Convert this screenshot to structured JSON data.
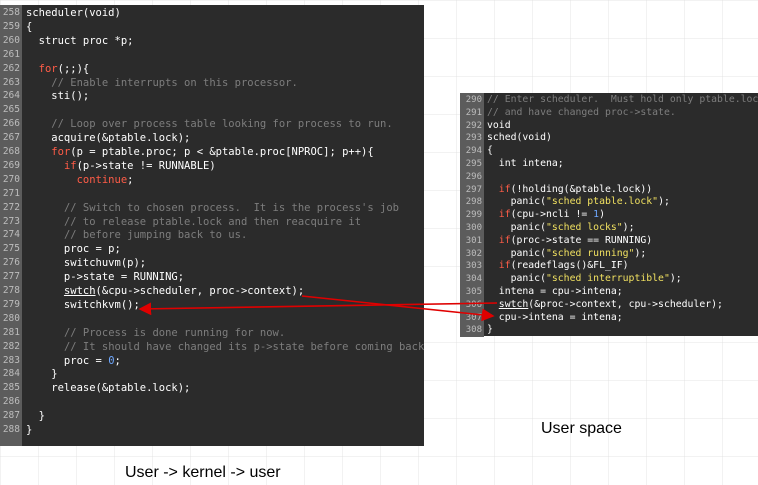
{
  "left_panel": {
    "lines": [
      {
        "num": "258",
        "segs": [
          {
            "t": "scheduler(void)"
          }
        ]
      },
      {
        "num": "259",
        "segs": [
          {
            "t": "{"
          }
        ]
      },
      {
        "num": "260",
        "segs": [
          {
            "t": "  struct proc *p;"
          }
        ]
      },
      {
        "num": "261",
        "segs": [
          {
            "t": ""
          }
        ]
      },
      {
        "num": "262",
        "segs": [
          {
            "t": "  "
          },
          {
            "t": "for",
            "c": "kw"
          },
          {
            "t": "(;;){"
          }
        ]
      },
      {
        "num": "263",
        "segs": [
          {
            "t": "    "
          },
          {
            "t": "// Enable interrupts on this processor.",
            "c": "cm"
          }
        ]
      },
      {
        "num": "264",
        "segs": [
          {
            "t": "    sti();"
          }
        ]
      },
      {
        "num": "265",
        "segs": [
          {
            "t": ""
          }
        ]
      },
      {
        "num": "266",
        "segs": [
          {
            "t": "    "
          },
          {
            "t": "// Loop over process table looking for process to run.",
            "c": "cm"
          }
        ]
      },
      {
        "num": "267",
        "segs": [
          {
            "t": "    acquire(&ptable.lock);"
          }
        ]
      },
      {
        "num": "268",
        "segs": [
          {
            "t": "    "
          },
          {
            "t": "for",
            "c": "kw"
          },
          {
            "t": "(p = ptable.proc; p < &ptable.proc[NPROC]; p++){"
          }
        ]
      },
      {
        "num": "269",
        "segs": [
          {
            "t": "      "
          },
          {
            "t": "if",
            "c": "kw"
          },
          {
            "t": "(p->state != RUNNABLE)"
          }
        ]
      },
      {
        "num": "270",
        "segs": [
          {
            "t": "        "
          },
          {
            "t": "continue",
            "c": "kw"
          },
          {
            "t": ";"
          }
        ]
      },
      {
        "num": "271",
        "segs": [
          {
            "t": ""
          }
        ]
      },
      {
        "num": "272",
        "segs": [
          {
            "t": "      "
          },
          {
            "t": "// Switch to chosen process.  It is the process's job",
            "c": "cm"
          }
        ]
      },
      {
        "num": "273",
        "segs": [
          {
            "t": "      "
          },
          {
            "t": "// to release ptable.lock and then reacquire it",
            "c": "cm"
          }
        ]
      },
      {
        "num": "274",
        "segs": [
          {
            "t": "      "
          },
          {
            "t": "// before jumping back to us.",
            "c": "cm"
          }
        ]
      },
      {
        "num": "275",
        "segs": [
          {
            "t": "      proc = p;"
          }
        ]
      },
      {
        "num": "276",
        "segs": [
          {
            "t": "      switchuvm(p);"
          }
        ]
      },
      {
        "num": "277",
        "segs": [
          {
            "t": "      p->state = RUNNING;"
          }
        ]
      },
      {
        "num": "278",
        "segs": [
          {
            "t": "      "
          },
          {
            "t": "swtch",
            "c": "ul"
          },
          {
            "t": "(&cpu->scheduler, proc->context);"
          }
        ]
      },
      {
        "num": "279",
        "segs": [
          {
            "t": "      switchkvm();"
          }
        ]
      },
      {
        "num": "280",
        "segs": [
          {
            "t": ""
          }
        ]
      },
      {
        "num": "281",
        "segs": [
          {
            "t": "      "
          },
          {
            "t": "// Process is done running for now.",
            "c": "cm"
          }
        ]
      },
      {
        "num": "282",
        "segs": [
          {
            "t": "      "
          },
          {
            "t": "// It should have changed its p->state before coming back.",
            "c": "cm"
          }
        ]
      },
      {
        "num": "283",
        "segs": [
          {
            "t": "      proc = "
          },
          {
            "t": "0",
            "c": "num"
          },
          {
            "t": ";"
          }
        ]
      },
      {
        "num": "284",
        "segs": [
          {
            "t": "    }"
          }
        ]
      },
      {
        "num": "285",
        "segs": [
          {
            "t": "    release(&ptable.lock);"
          }
        ]
      },
      {
        "num": "286",
        "segs": [
          {
            "t": ""
          }
        ]
      },
      {
        "num": "287",
        "segs": [
          {
            "t": "  }"
          }
        ]
      },
      {
        "num": "288",
        "segs": [
          {
            "t": "}"
          }
        ]
      }
    ]
  },
  "right_panel": {
    "lines": [
      {
        "num": "290",
        "segs": [
          {
            "t": "// Enter scheduler.  Must hold only ptable.lock",
            "c": "cm"
          }
        ]
      },
      {
        "num": "291",
        "segs": [
          {
            "t": "// and have changed proc->state.",
            "c": "cm"
          }
        ]
      },
      {
        "num": "292",
        "segs": [
          {
            "t": "void"
          }
        ]
      },
      {
        "num": "293",
        "segs": [
          {
            "t": "sched(void)"
          }
        ]
      },
      {
        "num": "294",
        "segs": [
          {
            "t": "{"
          }
        ]
      },
      {
        "num": "295",
        "segs": [
          {
            "t": "  int intena;"
          }
        ]
      },
      {
        "num": "296",
        "segs": [
          {
            "t": ""
          }
        ]
      },
      {
        "num": "297",
        "segs": [
          {
            "t": "  "
          },
          {
            "t": "if",
            "c": "kw"
          },
          {
            "t": "(!holding(&ptable.lock))"
          }
        ]
      },
      {
        "num": "298",
        "segs": [
          {
            "t": "    panic("
          },
          {
            "t": "\"sched ptable.lock\"",
            "c": "str"
          },
          {
            "t": ");"
          }
        ]
      },
      {
        "num": "299",
        "segs": [
          {
            "t": "  "
          },
          {
            "t": "if",
            "c": "kw"
          },
          {
            "t": "(cpu->ncli != "
          },
          {
            "t": "1",
            "c": "num"
          },
          {
            "t": ")"
          }
        ]
      },
      {
        "num": "300",
        "segs": [
          {
            "t": "    panic("
          },
          {
            "t": "\"sched locks\"",
            "c": "str"
          },
          {
            "t": ");"
          }
        ]
      },
      {
        "num": "301",
        "segs": [
          {
            "t": "  "
          },
          {
            "t": "if",
            "c": "kw"
          },
          {
            "t": "(proc->state == RUNNING)"
          }
        ]
      },
      {
        "num": "302",
        "segs": [
          {
            "t": "    panic("
          },
          {
            "t": "\"sched running\"",
            "c": "str"
          },
          {
            "t": ");"
          }
        ]
      },
      {
        "num": "303",
        "segs": [
          {
            "t": "  "
          },
          {
            "t": "if",
            "c": "kw"
          },
          {
            "t": "(readeflags()&FL_IF)"
          }
        ]
      },
      {
        "num": "304",
        "segs": [
          {
            "t": "    panic("
          },
          {
            "t": "\"sched interruptible\"",
            "c": "str"
          },
          {
            "t": ");"
          }
        ]
      },
      {
        "num": "305",
        "segs": [
          {
            "t": "  intena = cpu->intena;"
          }
        ]
      },
      {
        "num": "306",
        "segs": [
          {
            "t": "  "
          },
          {
            "t": "swtch",
            "c": "ul"
          },
          {
            "t": "(&proc->context, cpu->scheduler);"
          }
        ]
      },
      {
        "num": "307",
        "segs": [
          {
            "t": "  cpu->intena = intena;"
          }
        ]
      },
      {
        "num": "308",
        "segs": [
          {
            "t": "}"
          }
        ]
      }
    ]
  },
  "captions": {
    "user_space": "User space",
    "user_kernel_user": "User -> kernel -> user"
  },
  "colors": {
    "panel_bg": "#2b2b2b",
    "gutter_bg": "#5c5c5c",
    "keyword": "#ff5c47",
    "comment": "#7d7d7d",
    "string": "#f0e060",
    "number": "#6fa8ff",
    "arrow": "#e00000"
  }
}
